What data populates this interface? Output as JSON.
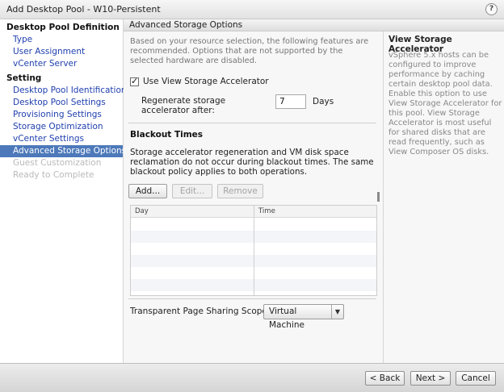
{
  "window": {
    "title": "Add Desktop Pool - W10-Persistent",
    "help_label": "?"
  },
  "nav": {
    "groups": [
      {
        "heading": "Desktop Pool Definition",
        "items": [
          "Type",
          "User Assignment",
          "vCenter Server"
        ]
      },
      {
        "heading": "Setting",
        "items": [
          "Desktop Pool Identification",
          "Desktop Pool Settings",
          "Provisioning Settings",
          "Storage Optimization",
          "vCenter Settings",
          "Advanced Storage Options",
          "Guest Customization",
          "Ready to Complete"
        ]
      }
    ],
    "active_item": "Advanced Storage Options",
    "disabled_items": [
      "Guest Customization",
      "Ready to Complete"
    ]
  },
  "section_title": "Advanced Storage Options",
  "main": {
    "intro": "Based on your resource selection, the following features are recommended. Options that are not supported by the selected hardware are disabled.",
    "view_storage_accelerator": {
      "label": "Use View Storage Accelerator",
      "checked": true
    },
    "regenerate_label": "Regenerate storage accelerator after:",
    "regenerate_value": "7",
    "regenerate_unit": "Days",
    "blackout_title": "Blackout Times",
    "blackout_desc": "Storage accelerator regeneration and VM disk space reclamation do not occur during blackout times. The same blackout policy applies to both operations.",
    "buttons": {
      "add": "Add...",
      "edit": "Edit...",
      "remove": "Remove"
    },
    "table": {
      "columns": [
        "Day",
        "Time"
      ],
      "rows": []
    },
    "tps_label": "Transparent Page Sharing Scope:",
    "tps_value": "Virtual Machine"
  },
  "help_panel": {
    "title": "View Storage Accelerator",
    "text": "vSphere 5.x hosts can be configured to improve performance by caching certain desktop pool data. Enable this option to use View Storage Accelerator for this pool. View Storage Accelerator is most useful for shared disks that are read frequently, such as View Composer OS disks."
  },
  "footer": {
    "back": "< Back",
    "next": "Next >",
    "cancel": "Cancel"
  },
  "icons": {
    "help": "help-icon",
    "dropdown": "chevron-down-icon",
    "checkbox": "checkmark-icon"
  }
}
